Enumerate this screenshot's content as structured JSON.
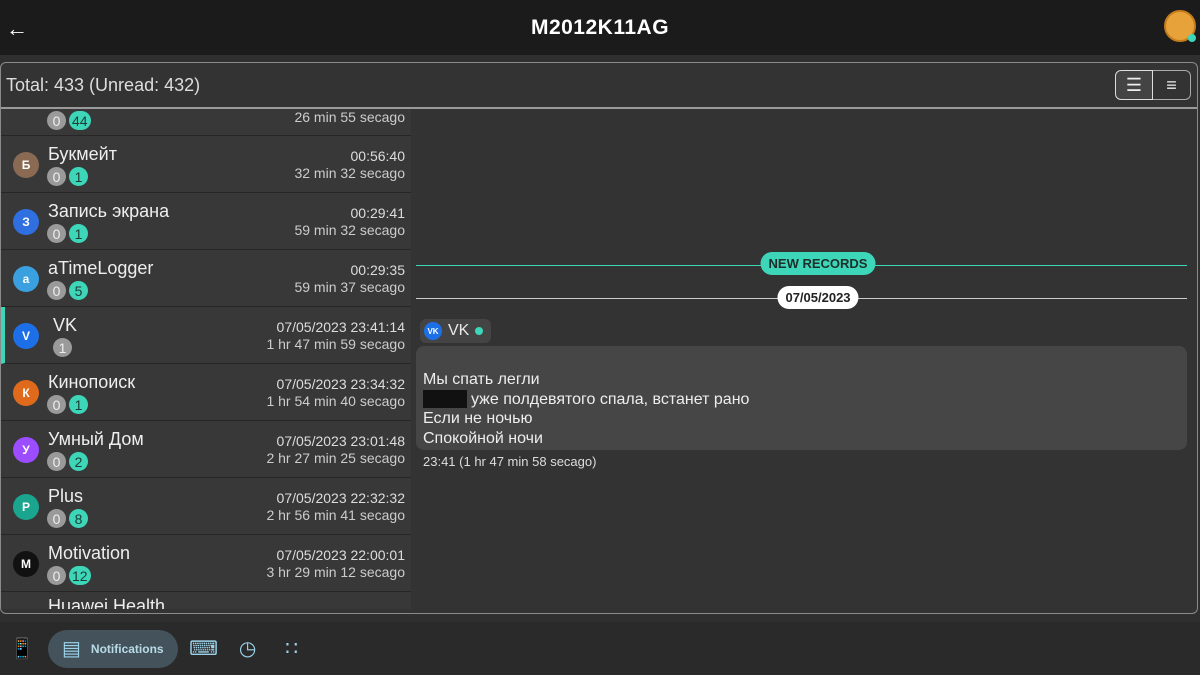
{
  "header": {
    "title": "M2012K11AG",
    "back_icon": "arrow-left-icon",
    "avatar_icon": "user-avatar"
  },
  "toolbar": {
    "summary": "Total: 433 (Unread: 432)",
    "view_list_icon": "list-view-icon",
    "view_compact_icon": "compact-view-icon"
  },
  "accent": "#3dd6b8",
  "partial_top": {
    "read": "0",
    "unread": "44",
    "ago": "26 min 55 secago"
  },
  "apps": [
    {
      "name": "Букмейт",
      "read": "0",
      "unread": "1",
      "time": "00:56:40",
      "ago": "32 min 32 secago",
      "color": "#8a6a52"
    },
    {
      "name": "Запись экрана",
      "read": "0",
      "unread": "1",
      "time": "00:29:41",
      "ago": "59 min 32 secago",
      "color": "#2f6fe0"
    },
    {
      "name": "aTimeLogger",
      "read": "0",
      "unread": "5",
      "time": "00:29:35",
      "ago": "59 min 37 secago",
      "color": "#3aa0e0"
    },
    {
      "name": "VK",
      "read": "1",
      "time": "07/05/2023 23:41:14",
      "ago": "1 hr 47 min 59 secago",
      "color": "#1d6fe8",
      "selected": true
    },
    {
      "name": "Кинопоиск",
      "read": "0",
      "unread": "1",
      "time": "07/05/2023 23:34:32",
      "ago": "1 hr 54 min 40 secago",
      "color": "#e06a1c"
    },
    {
      "name": "Умный Дом",
      "read": "0",
      "unread": "2",
      "time": "07/05/2023 23:01:48",
      "ago": "2 hr 27 min 25 secago",
      "color": "#9b4dff"
    },
    {
      "name": "Plus",
      "read": "0",
      "unread": "8",
      "time": "07/05/2023 22:32:32",
      "ago": "2 hr 56 min 41 secago",
      "color": "#1aa58f"
    },
    {
      "name": "Motivation",
      "read": "0",
      "unread": "12",
      "time": "07/05/2023 22:00:01",
      "ago": "3 hr 29 min 12 secago",
      "color": "#111111"
    }
  ],
  "partial_bottom": {
    "name": "Huawei Health"
  },
  "detail": {
    "new_records": "NEW RECORDS",
    "date": "07/05/2023",
    "app": "VK",
    "lines": [
      "Мы спать легли",
      "уже полдевятого спала, встанет рано",
      "Если не ночью",
      "Спокойной ночи"
    ],
    "time": "23:41 (1 hr 47 min 58 secago)"
  },
  "nav": {
    "notifications": "Notifications"
  }
}
